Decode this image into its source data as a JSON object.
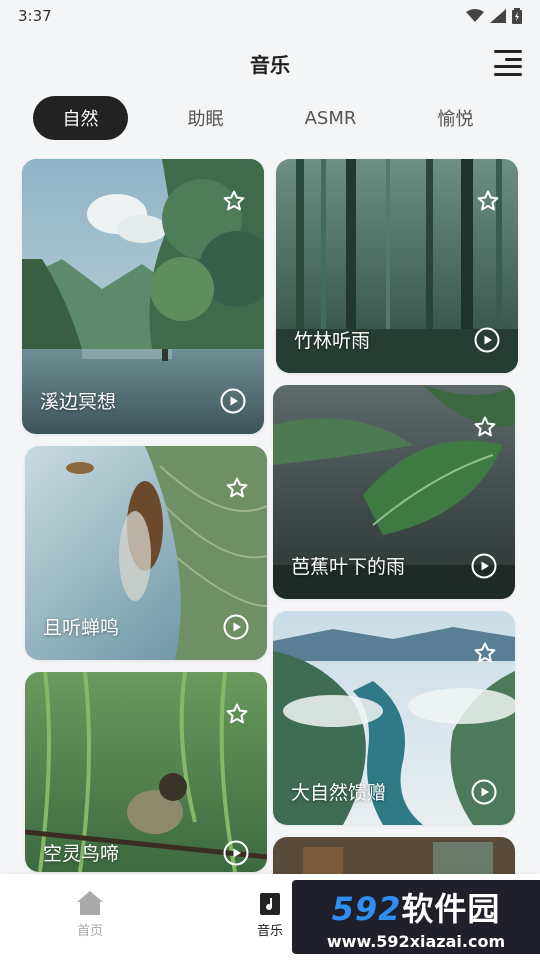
{
  "status_bar": {
    "time": "3:37"
  },
  "header": {
    "title": "音乐"
  },
  "tabs": [
    {
      "label": "自然"
    },
    {
      "label": "助眠"
    },
    {
      "label": "ASMR"
    },
    {
      "label": "愉悦"
    }
  ],
  "active_tab": "自然",
  "cards": [
    {
      "title": "溪边冥想"
    },
    {
      "title": "竹林听雨"
    },
    {
      "title": "且听蝉鸣"
    },
    {
      "title": "芭蕉叶下的雨"
    },
    {
      "title": "空灵鸟啼"
    },
    {
      "title": "大自然馈赠"
    }
  ],
  "bottom_nav": {
    "home_label": "首页",
    "music_label": "音乐"
  },
  "watermark": {
    "logo_number": "592",
    "logo_text": "软件园",
    "url": "www.592xiazai.com"
  },
  "colors": {
    "accent": "#222222",
    "background": "#f4f5f7",
    "watermark_blue": "#2f8ef2"
  }
}
